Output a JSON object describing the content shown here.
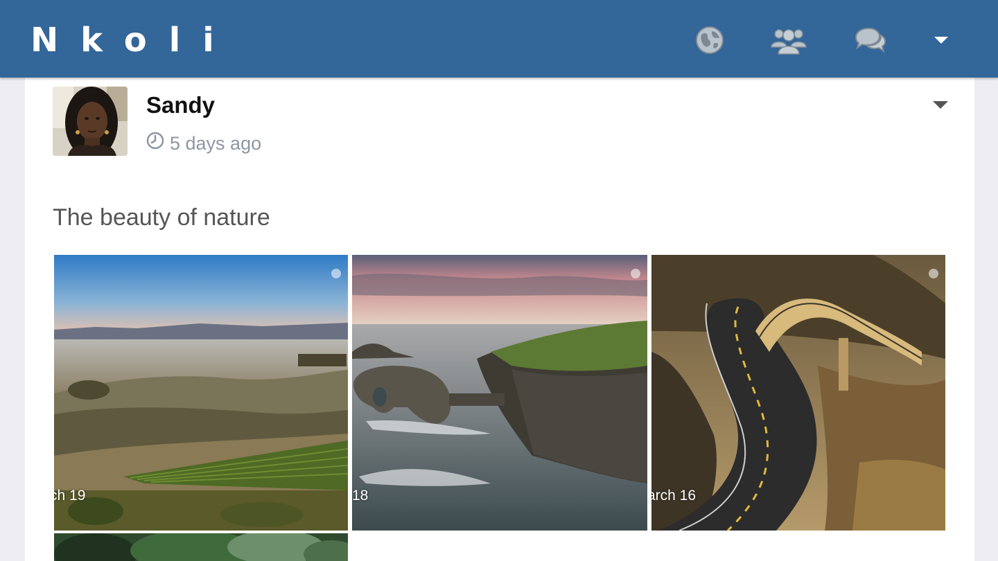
{
  "header": {
    "brand": "Nkoli",
    "nav": [
      {
        "name": "globe-icon"
      },
      {
        "name": "users-icon"
      },
      {
        "name": "chat-icon"
      },
      {
        "name": "caret-down-icon"
      }
    ],
    "colors": {
      "bar": "#336699",
      "icon": "#b8c2cc"
    }
  },
  "post": {
    "author": "Sandy",
    "time_ago": "5 days ago",
    "text": "The beauty of nature",
    "photos": [
      {
        "date_label": "ch 19",
        "subject": "misty rolling hills with vineyard"
      },
      {
        "date_label": "18",
        "subject": "sea arch and rocky coastline at dusk"
      },
      {
        "date_label": "arch 16",
        "subject": "curved coastal road bridge"
      },
      {
        "date_label": "",
        "subject": "green foliage (partially visible)"
      }
    ]
  }
}
